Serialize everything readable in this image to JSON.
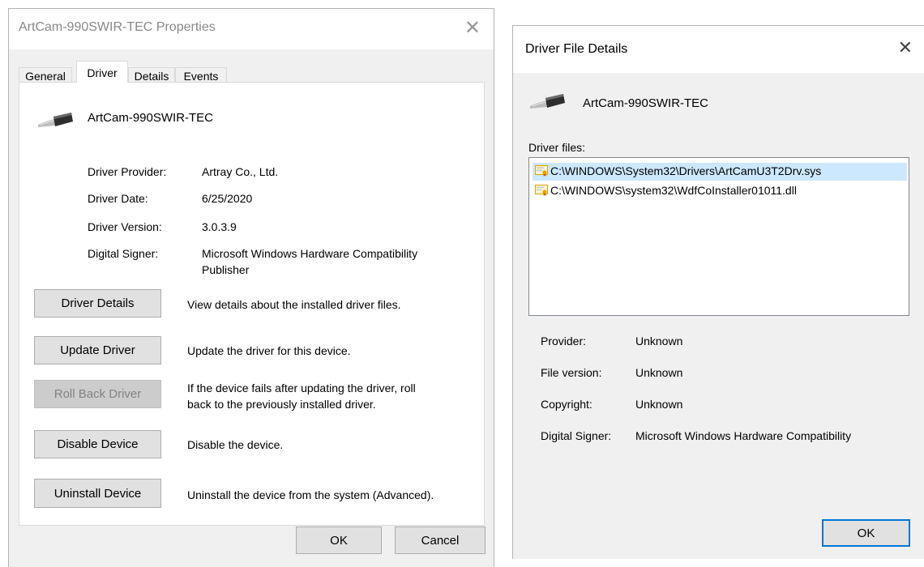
{
  "properties_window": {
    "title": "ArtCam-990SWIR-TEC Properties",
    "tabs": [
      {
        "label": "General"
      },
      {
        "label": "Driver"
      },
      {
        "label": "Details"
      },
      {
        "label": "Events"
      }
    ],
    "device_name": "ArtCam-990SWIR-TEC",
    "fields": {
      "provider_label": "Driver Provider:",
      "provider_value": "Artray Co., Ltd.",
      "date_label": "Driver Date:",
      "date_value": "6/25/2020",
      "version_label": "Driver Version:",
      "version_value": "3.0.3.9",
      "signer_label": "Digital Signer:",
      "signer_value_line1": "Microsoft Windows Hardware Compatibility",
      "signer_value_line2": "Publisher"
    },
    "actions": [
      {
        "button": "Driver Details",
        "description": "View details about the installed driver files."
      },
      {
        "button": "Update Driver",
        "description": "Update the driver for this device."
      },
      {
        "button": "Roll Back Driver",
        "description_line1": "If the device fails after updating the driver, roll",
        "description_line2": "back to the previously installed driver.",
        "disabled": true
      },
      {
        "button": "Disable Device",
        "description": "Disable the device."
      },
      {
        "button": "Uninstall Device",
        "description": "Uninstall the device from the system (Advanced)."
      }
    ],
    "ok_label": "OK",
    "cancel_label": "Cancel"
  },
  "file_details_window": {
    "title": "Driver File Details",
    "device_name": "ArtCam-990SWIR-TEC",
    "driver_files_label": "Driver files:",
    "files": [
      {
        "path": "C:\\WINDOWS\\System32\\Drivers\\ArtCamU3T2Drv.sys",
        "selected": true
      },
      {
        "path": "C:\\WINDOWS\\system32\\WdfCoInstaller01011.dll",
        "selected": false
      }
    ],
    "details": {
      "provider_label": "Provider:",
      "provider_value": "Unknown",
      "file_version_label": "File version:",
      "file_version_value": "Unknown",
      "copyright_label": "Copyright:",
      "copyright_value": "Unknown",
      "signer_label": "Digital Signer:",
      "signer_value": "Microsoft Windows Hardware Compatibility"
    },
    "ok_label": "OK"
  },
  "icons": {
    "device": "usb-plug-icon",
    "file": "certificate-file-icon",
    "close": "close-icon"
  },
  "colors": {
    "selection": "#cce8ff",
    "focus_border": "#0078d7",
    "dialog_bg": "#f0f0f0",
    "disabled_text": "#838383"
  }
}
